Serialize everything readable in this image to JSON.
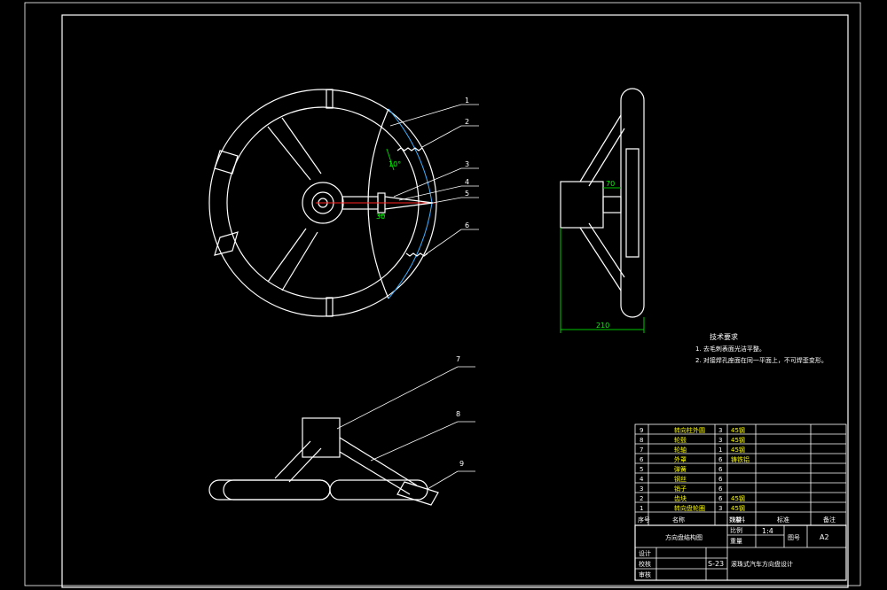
{
  "callouts": [
    "1",
    "2",
    "3",
    "4",
    "5",
    "6",
    "7",
    "8",
    "9"
  ],
  "dimensions": {
    "angle": "10°",
    "front_width": "30",
    "side_hub": "70",
    "side_overall": "210"
  },
  "notes": {
    "heading": "技术要求",
    "line1": "1. 去毛刺表面光洁平整。",
    "line2": "2. 对接焊孔座面在同一平面上，不可焊歪变形。"
  },
  "bom": {
    "rows": [
      {
        "no": "9",
        "name": "转向柱外圆",
        "qty": "3",
        "material": "45钢"
      },
      {
        "no": "8",
        "name": "轮毂",
        "qty": "3",
        "material": "45钢"
      },
      {
        "no": "7",
        "name": "轮轴",
        "qty": "1",
        "material": "45钢"
      },
      {
        "no": "6",
        "name": "外罩",
        "qty": "6",
        "material": "铸铁铝"
      },
      {
        "no": "5",
        "name": "弹簧",
        "qty": "6",
        "material": ""
      },
      {
        "no": "4",
        "name": "钢丝",
        "qty": "6",
        "material": ""
      },
      {
        "no": "3",
        "name": "销子",
        "qty": "6",
        "material": ""
      },
      {
        "no": "2",
        "name": "齿块",
        "qty": "6",
        "material": "45钢"
      },
      {
        "no": "1",
        "name": "转向盘轮圈",
        "qty": "3",
        "material": "45钢"
      }
    ],
    "headers": {
      "no": "序号",
      "name": "名称",
      "qty": "数量",
      "material": "材料",
      "standard": "标准",
      "remark": "备注"
    }
  },
  "title_block": {
    "drawing_name": "方向盘结构图",
    "scale_label": "比例",
    "scale_value": "1:4",
    "weight_label": "重量",
    "sheet_label": "图号",
    "sheet_value": "A2",
    "designer_label": "设计",
    "checker_label": "校核",
    "approver_label": "审核",
    "drawing_no": "S-23",
    "project_title": "滚珠式汽车方向盘设计"
  },
  "colors": {
    "line": "#ffffff",
    "dimension": "#00c800",
    "centerline": "#ff2020",
    "highlight": "#40b0ff",
    "bom_text": "#ffff00"
  }
}
